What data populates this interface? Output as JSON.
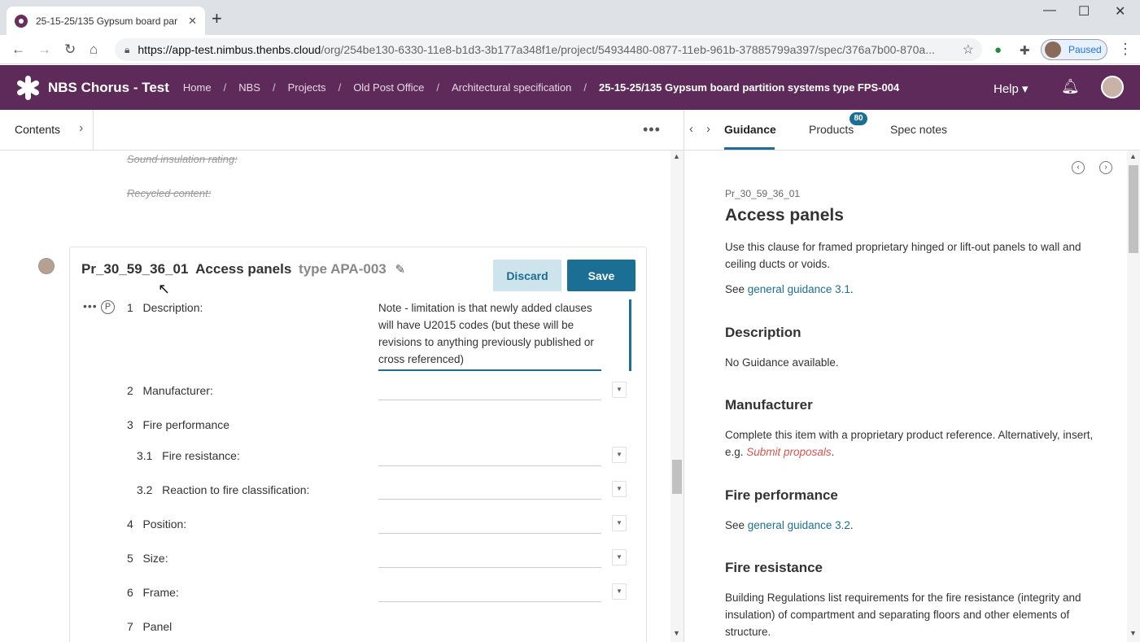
{
  "browser": {
    "tab_title": "25-15-25/135 Gypsum board par",
    "tab_close": "✕",
    "new_tab": "+",
    "minimize": "—",
    "maximize": "☐",
    "close": "✕",
    "url_host": "https://app-test.nimbus.thenbs.cloud",
    "url_path": "/org/254be130-6330-11e8-b1d3-3b177a348f1e/project/54934480-0877-11eb-961b-37885799a397/spec/376a7b00-870a...",
    "profile_label": "Paused"
  },
  "app": {
    "title": "NBS Chorus - Test",
    "breadcrumbs": [
      "Home",
      "NBS",
      "Projects",
      "Old Post Office",
      "Architectural specification"
    ],
    "breadcrumb_current": "25-15-25/135 Gypsum board partition systems type FPS-004",
    "help_label": "Help ▾",
    "brand_color": "#5d2a59"
  },
  "left": {
    "contents_label": "Contents",
    "struck_items": [
      "Sound insulation rating:",
      "Recycled content:"
    ],
    "clause": {
      "code": "Pr_30_59_36_01",
      "name": "Access panels",
      "type": "type APA-003",
      "discard_label": "Discard",
      "save_label": "Save",
      "p_badge": "P",
      "description_value": "Note - limitation is that newly added clauses will have U2015 codes (but these will be revisions to anything previously published or cross referenced)",
      "items": [
        {
          "num": "1",
          "label": "Description:"
        },
        {
          "num": "2",
          "label": "Manufacturer:"
        },
        {
          "num": "3",
          "label": "Fire performance"
        },
        {
          "num": "3.1",
          "label": "Fire resistance:"
        },
        {
          "num": "3.2",
          "label": "Reaction to fire classification:"
        },
        {
          "num": "4",
          "label": "Position:"
        },
        {
          "num": "5",
          "label": "Size:"
        },
        {
          "num": "6",
          "label": "Frame:"
        },
        {
          "num": "7",
          "label": "Panel"
        }
      ]
    }
  },
  "right": {
    "tabs": [
      "Guidance",
      "Products",
      "Spec notes"
    ],
    "products_count": "80",
    "code": "Pr_30_59_36_01",
    "title": "Access panels",
    "intro": "Use this clause for framed proprietary hinged or lift-out panels to wall and ceiling ducts or voids.",
    "see_prefix": "See ",
    "link_31": "general guidance 3.1",
    "link_32": "general guidance 3.2",
    "period": ".",
    "sections": {
      "description_head": "Description",
      "description_text": "No Guidance available.",
      "manufacturer_head": "Manufacturer",
      "manufacturer_text": "Complete this item with a proprietary product reference. Alternatively, insert, e.g. ",
      "manufacturer_em": "Submit proposals",
      "fire_perf_head": "Fire performance",
      "fire_res_head": "Fire resistance",
      "fire_res_text": "Building Regulations list requirements for the fire resistance (integrity and insulation) of compartment and separating floors and other elements of structure."
    }
  }
}
